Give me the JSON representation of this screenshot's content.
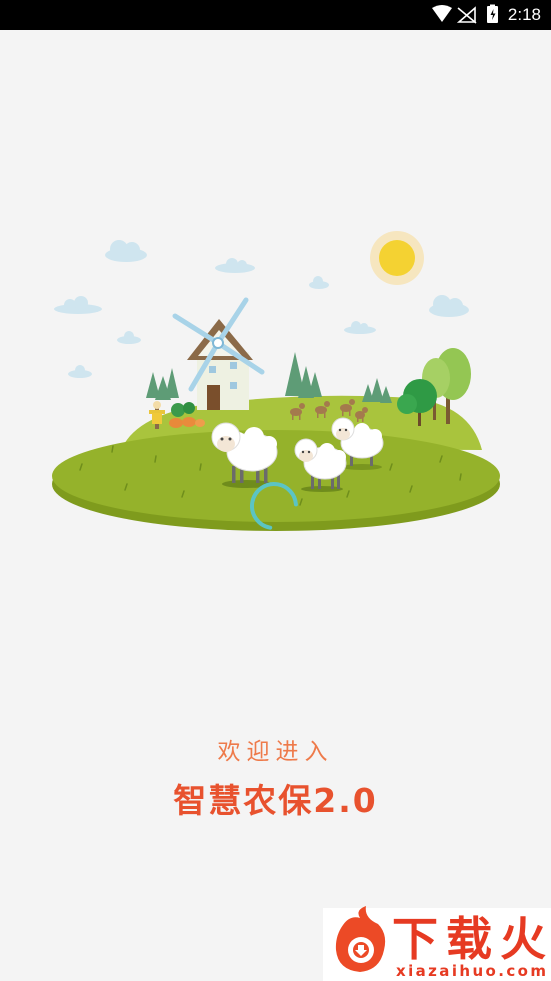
{
  "status_bar": {
    "time": "2:18",
    "icons": [
      "wifi-icon",
      "no-sim-signal-icon",
      "battery-charging-icon"
    ]
  },
  "splash": {
    "illustration": "farm-island",
    "loading": true
  },
  "welcome": {
    "line1": "欢迎进入",
    "line2": "智慧农保2.0"
  },
  "watermark": {
    "brand": "下载火",
    "url": "xiazaihuo.com"
  },
  "colors": {
    "background": "#f4f4f4",
    "welcome_line1": "#ee7a4a",
    "welcome_line2": "#e8522e",
    "spinner": "#5bc4c4",
    "watermark": "#e63a22"
  }
}
